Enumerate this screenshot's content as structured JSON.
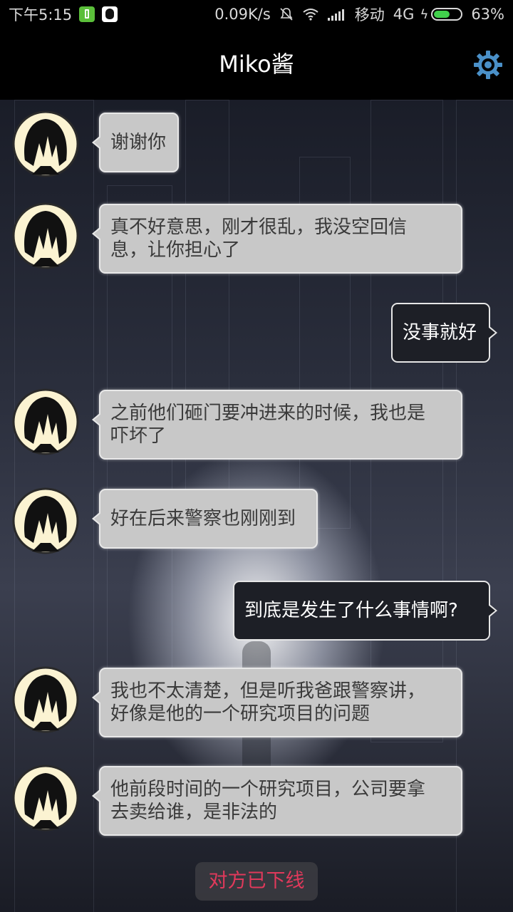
{
  "status_bar": {
    "time": "下午5:15",
    "net_speed": "0.09K/s",
    "carrier": "移动",
    "network_type": "4G",
    "battery_percent": "63%",
    "battery_level": 0.63,
    "icons": [
      "battery-app-icon",
      "qq-icon",
      "mute-icon",
      "wifi-icon",
      "signal-icon",
      "charging-icon",
      "battery-icon"
    ]
  },
  "header": {
    "title": "Miko酱",
    "settings_icon": "gear-icon"
  },
  "messages": [
    {
      "from": "other",
      "text": "谢谢你"
    },
    {
      "from": "other",
      "text": "真不好意思，刚才很乱，我没空回信\n息，让你担心了"
    },
    {
      "from": "me",
      "text": "没事就好"
    },
    {
      "from": "other",
      "text": "之前他们砸门要冲进来的时候，我也是\n吓坏了"
    },
    {
      "from": "other",
      "text": "好在后来警察也刚刚到"
    },
    {
      "from": "me",
      "text": "到底是发生了什么事情啊?"
    },
    {
      "from": "other",
      "text": "我也不太清楚，但是听我爸跟警察讲，\n好像是他的一个研究项目的问题"
    },
    {
      "from": "other",
      "text": "他前段时间的一个研究项目，公司要拿\n去卖给谁，是非法的"
    }
  ],
  "status_notice": "对方已下线",
  "colors": {
    "incoming_bubble": "#c8c8c8",
    "outgoing_bubble": "#1d1f26",
    "notice_text": "#e0395b",
    "gear": "#4a90c8",
    "battery": "#41d14c"
  }
}
